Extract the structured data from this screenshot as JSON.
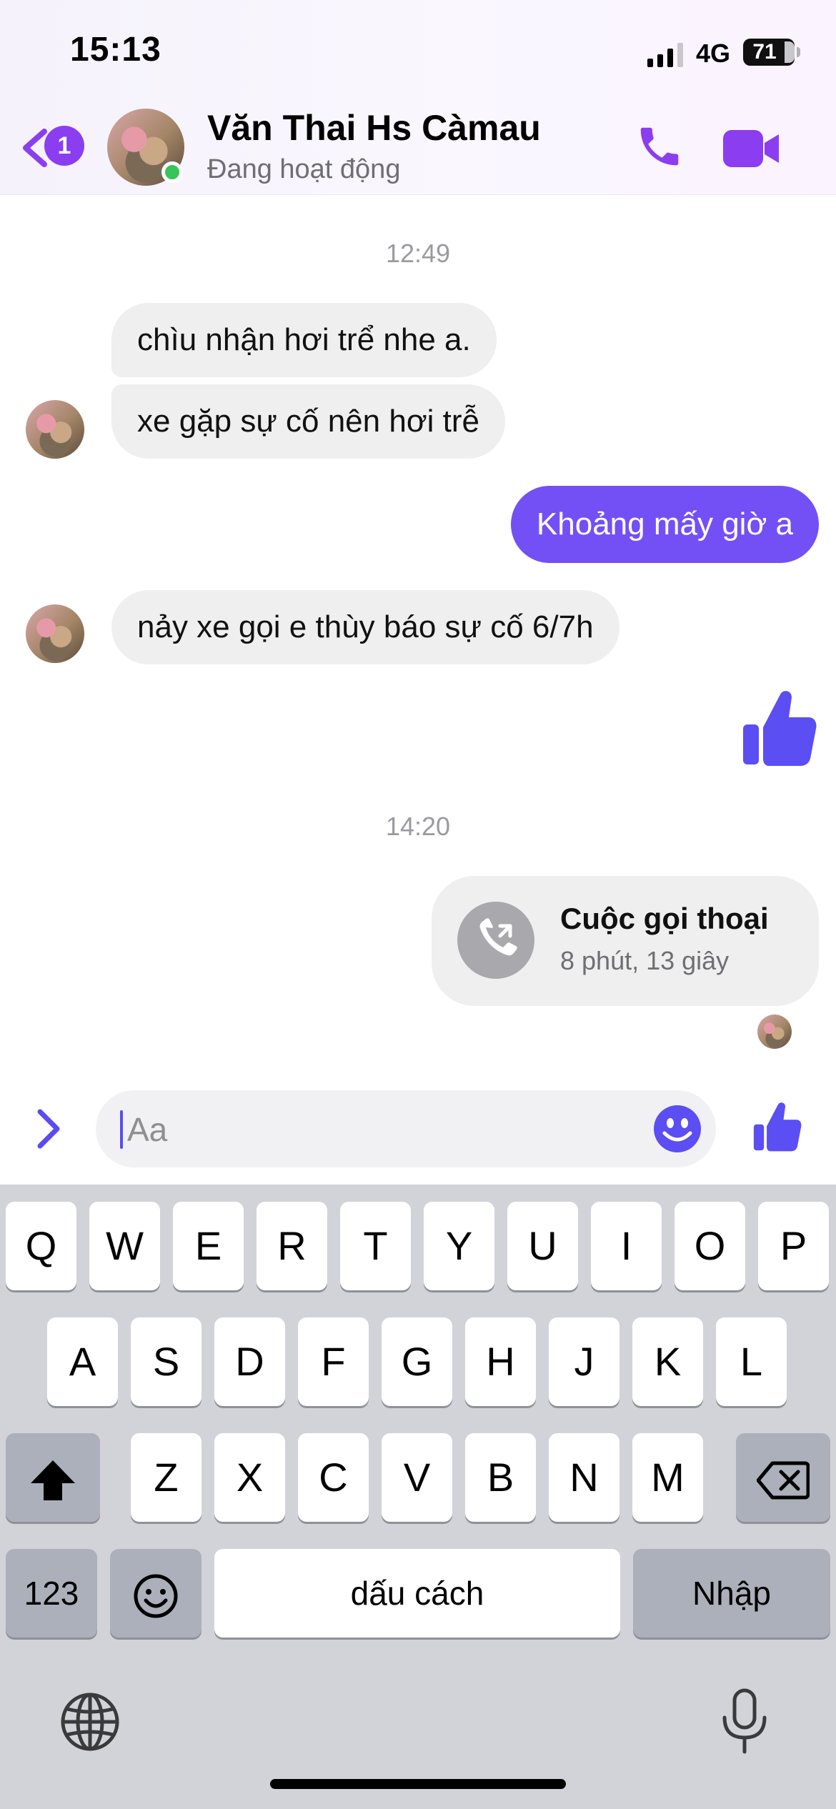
{
  "status_bar": {
    "time": "15:13",
    "network": "4G",
    "battery": "71"
  },
  "header": {
    "back_badge": "1",
    "contact_name": "Văn Thai Hs Càmau",
    "contact_status": "Đang hoạt động",
    "icons": [
      "chevron-left-icon",
      "phone-icon",
      "video-camera-icon"
    ]
  },
  "messages": {
    "time_1": "12:49",
    "in_1": "chìu nhận hơi trể nhe a.",
    "in_2": "xe gặp sự cố nên hơi trễ",
    "out_1": "Khoảng mấy giờ a",
    "in_3": "nảy xe gọi e thùy báo sự cố 6/7h",
    "sticker": "thumbs-up",
    "time_2": "14:20",
    "call_title": "Cuộc gọi thoại",
    "call_duration": "8 phút, 13 giây"
  },
  "composer": {
    "placeholder": "Aa"
  },
  "keyboard": {
    "row1": [
      "Q",
      "W",
      "E",
      "R",
      "T",
      "Y",
      "U",
      "I",
      "O",
      "P"
    ],
    "row2": [
      "A",
      "S",
      "D",
      "F",
      "G",
      "H",
      "J",
      "K",
      "L"
    ],
    "row3": [
      "Z",
      "X",
      "C",
      "V",
      "B",
      "N",
      "M"
    ],
    "numbers": "123",
    "space": "dấu cách",
    "return": "Nhập"
  },
  "colors": {
    "accent": "#7350f5",
    "header_purple": "#8a3ef0",
    "online": "#38c558"
  }
}
